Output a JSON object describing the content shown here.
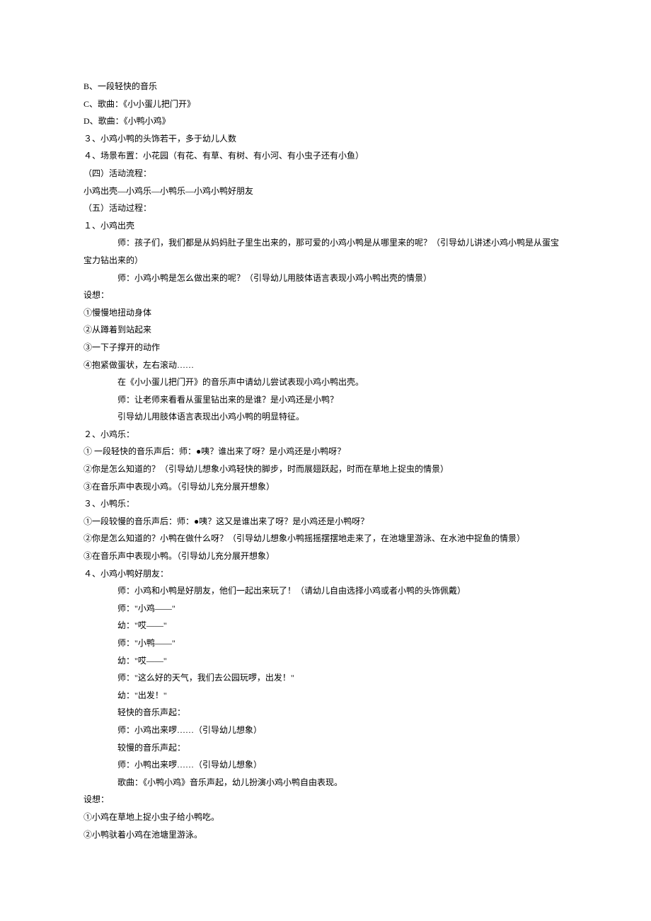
{
  "lines": [
    {
      "t": "B、一段轻快的音乐",
      "cls": ""
    },
    {
      "t": "C、歌曲：《小小蛋儿把门开》",
      "cls": ""
    },
    {
      "t": "D、歌曲：《小鸭小鸡》",
      "cls": ""
    },
    {
      "t": "３、小鸡小鸭的头饰若干，多于幼儿人数",
      "cls": ""
    },
    {
      "t": "４、场景布置：小花园（有花、有草、有树、有小河、有小虫子还有小鱼）",
      "cls": ""
    },
    {
      "t": "（四）活动流程：",
      "cls": ""
    },
    {
      "t": "小鸡出壳—小鸡乐—小鸭乐—小鸡小鸭好朋友",
      "cls": ""
    },
    {
      "t": "（五）活动过程：",
      "cls": ""
    },
    {
      "t": "１、小鸡出壳",
      "cls": ""
    },
    {
      "t": "师：孩子们，我们都是从妈妈肚子里生出来的，那可爱的小鸡小鸭是从哪里来的呢？（引导幼儿讲述小鸡小鸭是从蛋宝",
      "cls": "indent-1"
    },
    {
      "t": "宝力钻出来的）",
      "cls": "no-indent-wrap"
    },
    {
      "t": "师：小鸡小鸭是怎么做出来的呢？（引导幼儿用肢体语言表现小鸡小鸭出壳的情景）",
      "cls": "indent-1"
    },
    {
      "t": "设想：",
      "cls": ""
    },
    {
      "t": "①慢慢地扭动身体",
      "cls": ""
    },
    {
      "t": "②从蹲着到站起来",
      "cls": ""
    },
    {
      "t": "③一下子撑开的动作",
      "cls": ""
    },
    {
      "t": "④抱紧做蛋状，左右滚动……",
      "cls": ""
    },
    {
      "t": "在《小小蛋儿把门开》的音乐声中请幼儿尝试表现小鸡小鸭出壳。",
      "cls": "indent-1"
    },
    {
      "t": "师：让老师来看看从蛋里钻出来的是谁？是小鸡还是小鸭？",
      "cls": "indent-1"
    },
    {
      "t": "引导幼儿用肢体语言表现出小鸡小鸭的明显特征。",
      "cls": "indent-1"
    },
    {
      "t": "２、小鸡乐：",
      "cls": ""
    },
    {
      "t": "① 一段轻快的音乐声后：师：●咦？谁出来了呀？是小鸡还是小鸭呀？",
      "cls": ""
    },
    {
      "t": "②你是怎么知道的？（引导幼儿想象小鸡轻快的脚步，时而展翅跃起，时而在草地上捉虫的情景）",
      "cls": ""
    },
    {
      "t": "③在音乐声中表现小鸡。（引导幼儿充分展开想象）",
      "cls": ""
    },
    {
      "t": "３、小鸭乐：",
      "cls": ""
    },
    {
      "t": "①一段较慢的音乐声后：师：●咦？这又是谁出来了呀？是小鸡还是小鸭呀？",
      "cls": ""
    },
    {
      "t": "②你是怎么知道的？小鸭在做什么呀？（引导幼儿想象小鸭摇摇摆摆地走来了，在池塘里游泳、在水池中捉鱼的情景）",
      "cls": ""
    },
    {
      "t": "③在音乐声中表现小鸭。（引导幼儿充分展开想象）",
      "cls": ""
    },
    {
      "t": "４、小鸡小鸭好朋友：",
      "cls": ""
    },
    {
      "t": "师：小鸡和小鸭是好朋友，他们一起出来玩了！（请幼儿自由选择小鸡或者小鸭的头饰佩戴）",
      "cls": "indent-1"
    },
    {
      "t": "师：\"小鸡——\"",
      "cls": "indent-1"
    },
    {
      "t": "幼：\"哎——\"",
      "cls": "indent-1"
    },
    {
      "t": "师：\"小鸭——\"",
      "cls": "indent-1"
    },
    {
      "t": "幼：\"哎——\"",
      "cls": "indent-1"
    },
    {
      "t": "师：\"这么好的天气，我们去公园玩啰，出发！\"",
      "cls": "indent-1"
    },
    {
      "t": "幼：\"出发！\"",
      "cls": "indent-1"
    },
    {
      "t": "轻快的音乐声起：",
      "cls": "indent-1"
    },
    {
      "t": "师：小鸡出来啰……（引导幼儿想象）",
      "cls": "indent-1"
    },
    {
      "t": "较慢的音乐声起：",
      "cls": "indent-1"
    },
    {
      "t": "师：小鸭出来啰……（引导幼儿想象）",
      "cls": "indent-1"
    },
    {
      "t": "歌曲：《小鸭小鸡》音乐声起，幼儿扮演小鸡小鸭自由表现。",
      "cls": "indent-1"
    },
    {
      "t": "设想：",
      "cls": ""
    },
    {
      "t": "①小鸡在草地上捉小虫子给小鸭吃。",
      "cls": ""
    },
    {
      "t": "②小鸭驮着小鸡在池塘里游泳。",
      "cls": ""
    }
  ]
}
